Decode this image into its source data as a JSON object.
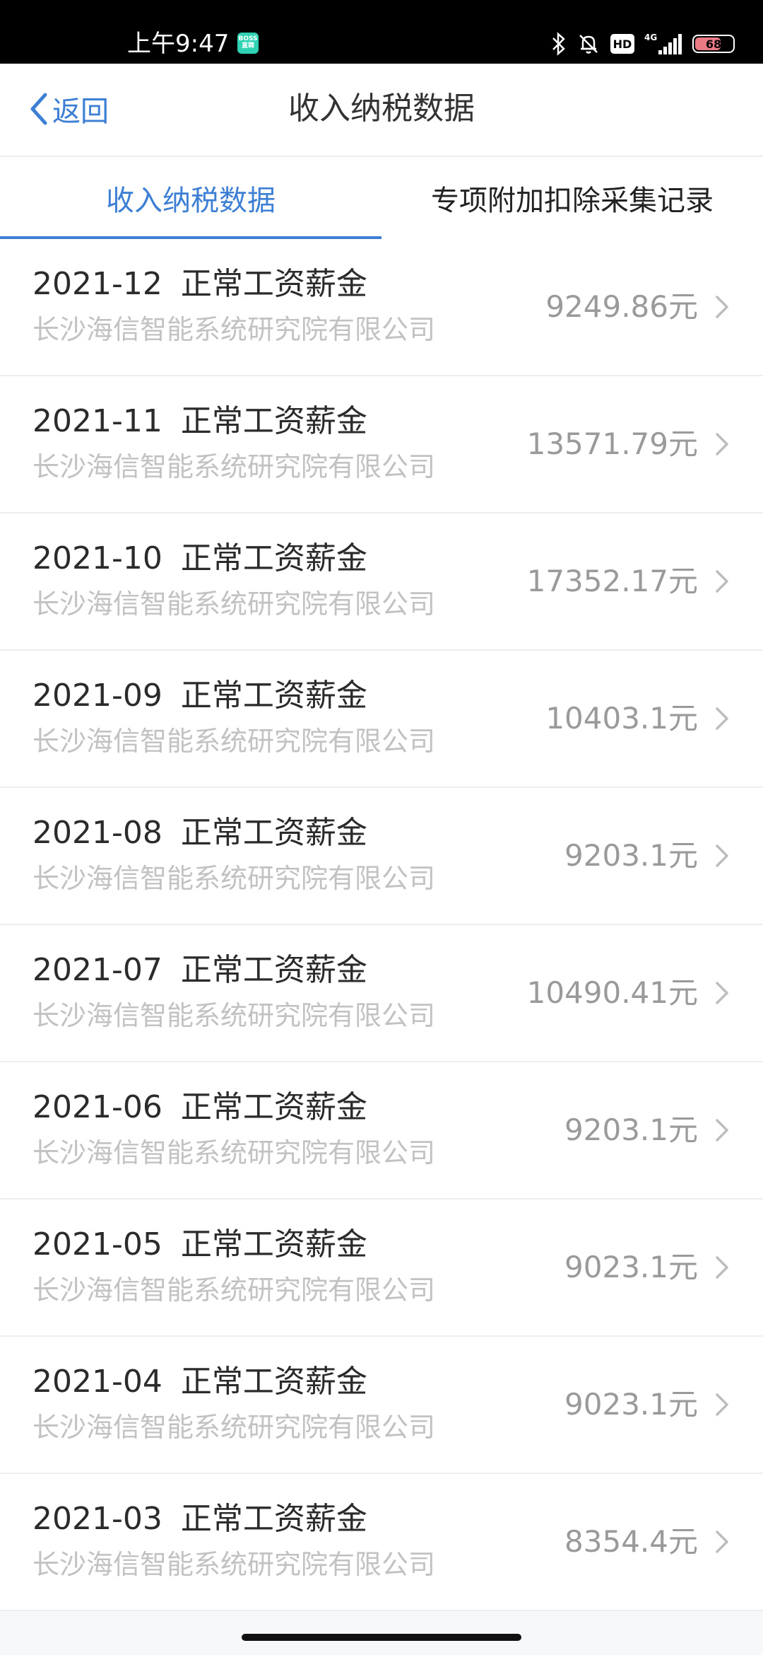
{
  "status_bar": {
    "time": "上午9:47",
    "boss_badge": "BOSS\n直聘",
    "hd_label": "HD",
    "network_label": "4G",
    "battery_level": "68"
  },
  "nav": {
    "back_label": "返回",
    "title": "收入纳税数据"
  },
  "tabs": [
    {
      "label": "收入纳税数据",
      "active": true
    },
    {
      "label": "专项附加扣除采集记录",
      "active": false
    }
  ],
  "records": [
    {
      "period": "2021-12",
      "type": "正常工资薪金",
      "company": "长沙海信智能系统研究院有限公司",
      "amount": "9249.86元"
    },
    {
      "period": "2021-11",
      "type": "正常工资薪金",
      "company": "长沙海信智能系统研究院有限公司",
      "amount": "13571.79元"
    },
    {
      "period": "2021-10",
      "type": "正常工资薪金",
      "company": "长沙海信智能系统研究院有限公司",
      "amount": "17352.17元"
    },
    {
      "period": "2021-09",
      "type": "正常工资薪金",
      "company": "长沙海信智能系统研究院有限公司",
      "amount": "10403.1元"
    },
    {
      "period": "2021-08",
      "type": "正常工资薪金",
      "company": "长沙海信智能系统研究院有限公司",
      "amount": "9203.1元"
    },
    {
      "period": "2021-07",
      "type": "正常工资薪金",
      "company": "长沙海信智能系统研究院有限公司",
      "amount": "10490.41元"
    },
    {
      "period": "2021-06",
      "type": "正常工资薪金",
      "company": "长沙海信智能系统研究院有限公司",
      "amount": "9203.1元"
    },
    {
      "period": "2021-05",
      "type": "正常工资薪金",
      "company": "长沙海信智能系统研究院有限公司",
      "amount": "9023.1元"
    },
    {
      "period": "2021-04",
      "type": "正常工资薪金",
      "company": "长沙海信智能系统研究院有限公司",
      "amount": "9023.1元"
    },
    {
      "period": "2021-03",
      "type": "正常工资薪金",
      "company": "长沙海信智能系统研究院有限公司",
      "amount": "8354.4元"
    }
  ],
  "colors": {
    "accent": "#3d7fd4",
    "title_text": "#2b2b2b",
    "secondary_text": "#c2c2c2",
    "amount_text": "#9a9a9a"
  }
}
